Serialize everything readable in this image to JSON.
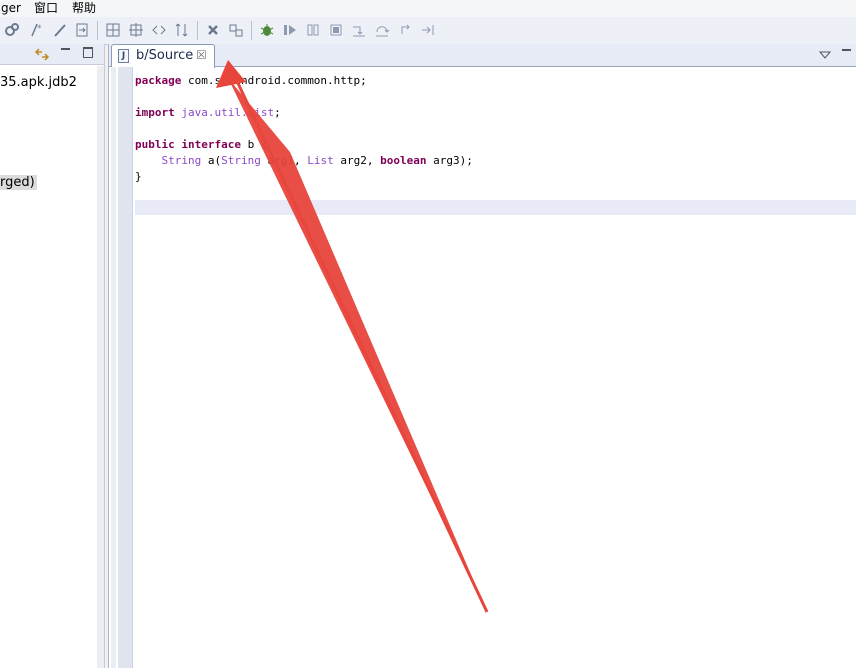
{
  "menu": {
    "items": [
      {
        "label": "ger"
      },
      {
        "label": "窗口"
      },
      {
        "label": "帮助"
      }
    ]
  },
  "toolbar": {
    "buttons": [
      "debug-config-icon",
      "toggle-comment-icon",
      "edit-icon",
      "step-filter-icon",
      "grid-icon",
      "grid2-icon",
      "link-icon",
      "branch-icon",
      "terminate-icon",
      "disconnect-icon",
      "bug-icon",
      "resume-icon",
      "suspend-icon",
      "stop-icon",
      "step-into-icon",
      "step-over-icon",
      "step-return-icon",
      "drop-to-frame-icon"
    ]
  },
  "left_panel": {
    "tree_items": [
      {
        "label": "35.apk.jdb2",
        "selected": false
      },
      {
        "label": "rged)",
        "selected": true
      }
    ]
  },
  "editor": {
    "tab": {
      "title": "b/Source",
      "icon": "J"
    },
    "code_lines": [
      [
        {
          "t": "kw",
          "v": "package"
        },
        {
          "t": "tx",
          "v": " com.ss.android.common.http;"
        }
      ],
      [],
      [
        {
          "t": "kw",
          "v": "import"
        },
        {
          "t": "tx",
          "v": " "
        },
        {
          "t": "ty",
          "v": "java.util.List"
        },
        {
          "t": "tx",
          "v": ";"
        }
      ],
      [],
      [
        {
          "t": "kw",
          "v": "public interface"
        },
        {
          "t": "tx",
          "v": " b {"
        }
      ],
      [
        {
          "t": "tx",
          "v": "    "
        },
        {
          "t": "ty",
          "v": "String"
        },
        {
          "t": "tx",
          "v": " a("
        },
        {
          "t": "ty",
          "v": "String"
        },
        {
          "t": "tx",
          "v": " arg1, "
        },
        {
          "t": "ty",
          "v": "List"
        },
        {
          "t": "tx",
          "v": " arg2, "
        },
        {
          "t": "kw",
          "v": "boolean"
        },
        {
          "t": "tx",
          "v": " arg3);"
        }
      ],
      [
        {
          "t": "tx",
          "v": "}"
        }
      ]
    ]
  },
  "colors": {
    "keyword": "#7f0055",
    "type": "#8a4ac8",
    "arrow": "#e8453c"
  }
}
